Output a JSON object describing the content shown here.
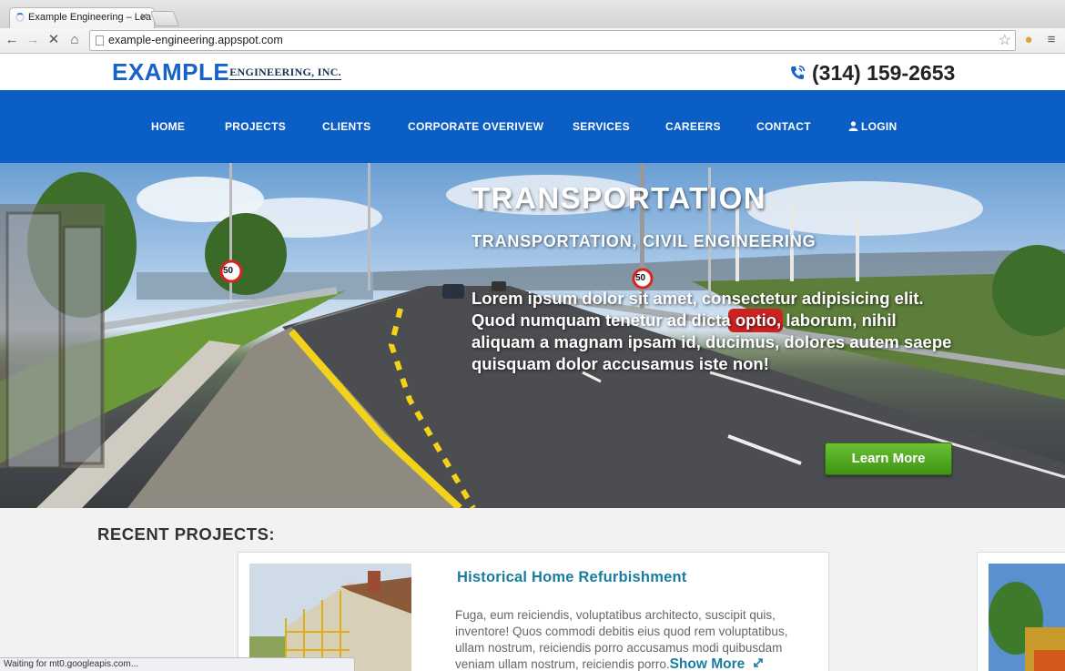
{
  "browser": {
    "tab_title": "Example Engineering – Lea",
    "tab_close": "✕",
    "url": "example-engineering.appspot.com",
    "status": "Waiting for mt0.googleapis.com..."
  },
  "header": {
    "logo_main": "EXAMPLE",
    "logo_sub": "ENGINEERING, INC.",
    "phone": "(314) 159-2653"
  },
  "nav": {
    "items": [
      "HOME",
      "PROJECTS",
      "CLIENTS",
      "CORPORATE OVERIVEW",
      "SERVICES",
      "CAREERS",
      "CONTACT",
      "LOGIN"
    ]
  },
  "hero": {
    "title": "TRANSPORTATION",
    "subtitle": "TRANSPORTATION, CIVIL ENGINEERING",
    "text": "Lorem ipsum dolor sit amet, consectetur adipisicing elit. Quod numquam tenetur ad dicta optio, laborum, nihil aliquam a magnam ipsam id, ducimus, dolores autem saepe quisquam dolor accusamus iste non!",
    "button": "Learn More",
    "sign_speed": "50"
  },
  "recent": {
    "title": "RECENT PROJECTS:",
    "projects": [
      {
        "title": "Historical Home Refurbishment",
        "text": "Fuga, eum reiciendis, voluptatibus architecto, suscipit quis, inventore! Quos commodi debitis eius quod rem voluptatibus, ullam nostrum, reiciendis porro accusamus modi quibusdam veniam ullam nostrum, reiciendis porro.",
        "more": "Show More"
      }
    ]
  },
  "colors": {
    "brand_blue": "#0a5ec6",
    "accent_teal": "#1a7ca0",
    "button_green": "#4fa91e"
  }
}
